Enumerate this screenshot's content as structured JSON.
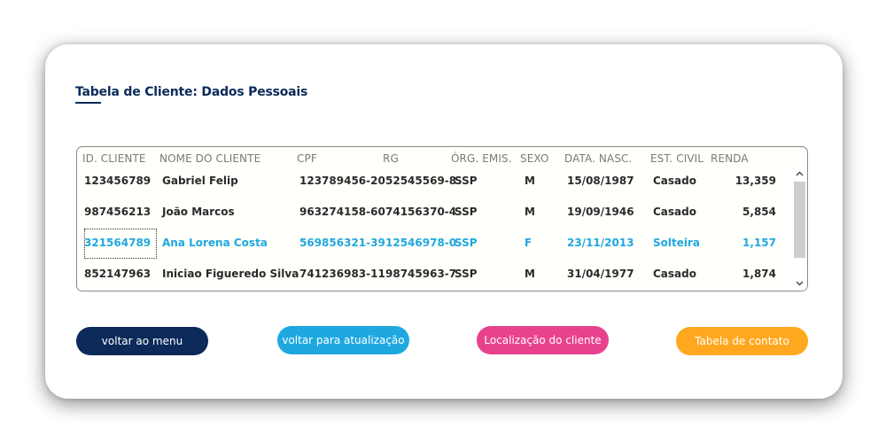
{
  "page": {
    "title": "Tabela de Cliente: Dados Pessoais"
  },
  "table": {
    "headers": [
      "ID. CLIENTE",
      "NOME DO CLIENTE",
      "CPF",
      "RG",
      "ÓRG. EMIS.",
      "SEXO",
      "DATA. NASC.",
      "EST. CIVIL",
      "RENDA"
    ],
    "rows": [
      {
        "id": "123456789",
        "nome": "Gabriel Felip",
        "cpf": "123789456-20",
        "rg": "52545569-8",
        "org": "SSP",
        "sexo": "M",
        "nasc": "15/08/1987",
        "civil": "Casado",
        "renda": "13,359"
      },
      {
        "id": "987456213",
        "nome": "João Marcos",
        "cpf": "963274158-60",
        "rg": "74156370-4",
        "org": "SSP",
        "sexo": "M",
        "nasc": "19/09/1946",
        "civil": "Casado",
        "renda": "5,854"
      },
      {
        "id": "321564789",
        "nome": "Ana Lorena Costa",
        "cpf": "569856321-39",
        "rg": "12546978-0",
        "org": "SSP",
        "sexo": "F",
        "nasc": "23/11/2013",
        "civil": "Solteira",
        "renda": "1,157"
      },
      {
        "id": "852147963",
        "nome": "Iniciao Figueredo Silva",
        "cpf": "741236983-11",
        "rg": "98745963-7",
        "org": "SSP",
        "sexo": "M",
        "nasc": "31/04/1977",
        "civil": "Casado",
        "renda": "1,874"
      }
    ],
    "selected_row_index": 2,
    "scroll_up_icon": "chevron-up-icon",
    "scroll_down_icon": "chevron-down-icon"
  },
  "buttons": {
    "menu": "voltar ao menu",
    "atualizacao": "voltar para atualização",
    "localizacao": "Localização do cliente",
    "contato": "Tabela de contato"
  },
  "colors": {
    "navy": "#0b2a5a",
    "blue": "#1fa8e0",
    "pink": "#e8428e",
    "orange": "#ffa81f"
  }
}
